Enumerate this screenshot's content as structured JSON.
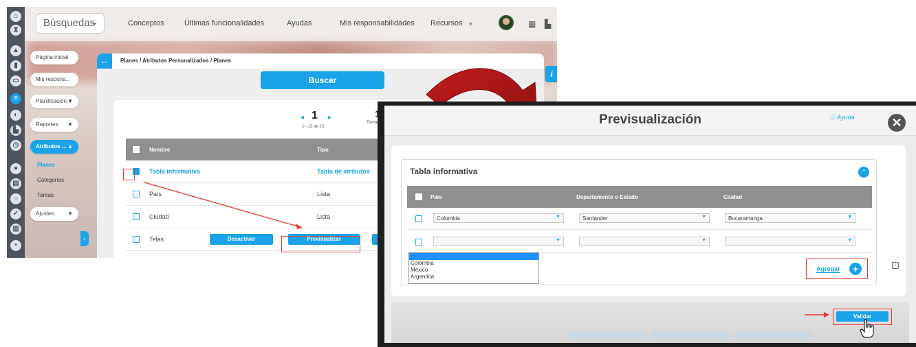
{
  "left": {
    "search_label": "Búsquedas",
    "nav": [
      "Conceptos",
      "Últimas funcionalidades",
      "Ayudas",
      "Mis responsabilidades",
      "Recursos"
    ],
    "sidebar": {
      "items": [
        {
          "label": "Página inicial"
        },
        {
          "label": "Mis respons..."
        },
        {
          "label": "Planificación"
        },
        {
          "label": "Reportes"
        },
        {
          "label": "Atributos ..."
        },
        {
          "label": "Ajustes"
        }
      ],
      "sub_items": [
        "Planes",
        "Categorías",
        "Tareas"
      ]
    },
    "breadcrumb": "Planes / Atributos Personalizados / Planes",
    "buscar": "Buscar",
    "pager": {
      "page": "1",
      "range": "1 - 13 de 13",
      "per_page": "10",
      "per_page_label": "Elemen"
    },
    "table": {
      "headers": {
        "name": "Nombre",
        "type": "Tipo"
      },
      "rows": [
        {
          "name": "Tabla informativa",
          "type": "Tabla de atributos"
        },
        {
          "name": "País",
          "type": "Lista"
        },
        {
          "name": "Ciudad",
          "type": "Lista"
        },
        {
          "name": "Telas",
          "type": ""
        }
      ]
    },
    "actions": {
      "deactivate": "Desactivar",
      "preview": "Previsualizar"
    }
  },
  "modal": {
    "title": "Previsualización",
    "help": "Ayuda",
    "section_title": "Tabla informativa",
    "columns": {
      "country": "País",
      "state": "Departamento o Estado",
      "city": "Ciudad"
    },
    "rows": [
      {
        "country": "Colombia",
        "state": "Santander",
        "city": "Bucaramanga"
      },
      {
        "country": "",
        "state": "",
        "city": ""
      }
    ],
    "dropdown_options": [
      "Colombia",
      "Mexico",
      "Argentina"
    ],
    "add_label": "Agregar",
    "validate_label": "Validar"
  },
  "colors": {
    "accent": "#1aa3e8",
    "highlight": "#e53935",
    "header_gray": "#8f8f8f"
  }
}
